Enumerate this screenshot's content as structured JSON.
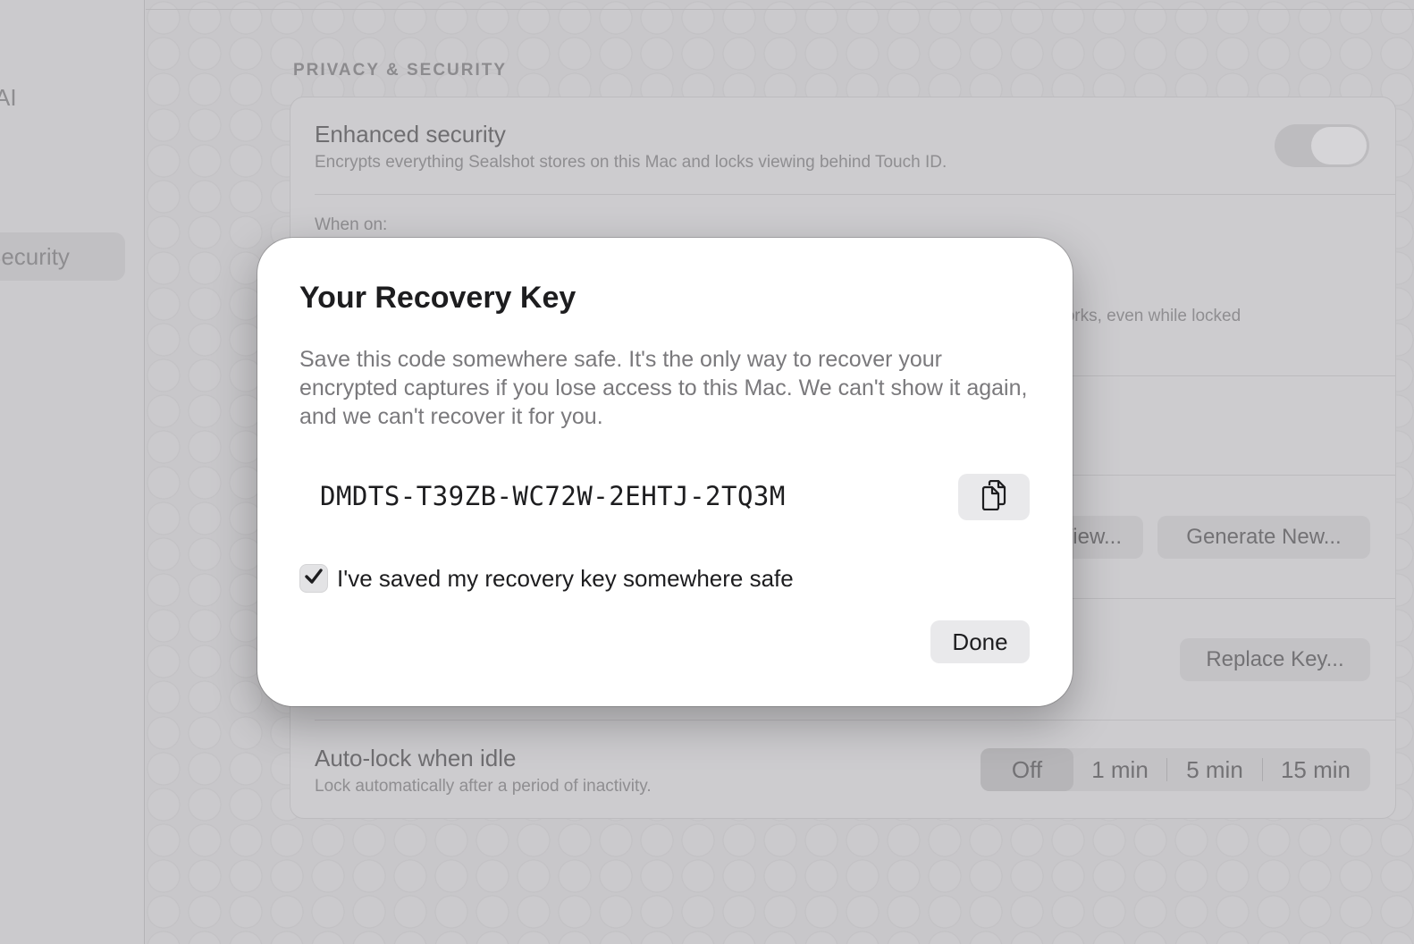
{
  "sidebar": {
    "items": [
      {
        "label": "AI"
      },
      {
        "label": "Security"
      }
    ]
  },
  "settings": {
    "section_title": "PRIVACY & SECURITY",
    "enhanced_security": {
      "title": "Enhanced security",
      "subtitle": "Encrypts everything Sealshot stores on this Mac and locks viewing behind Touch ID.",
      "enabled": true
    },
    "when_on_label": "When on:",
    "partial_text": "works, even while locked",
    "view_button_partial": "View...",
    "generate_button": "Generate New...",
    "replace_button": "Replace Key...",
    "auto_lock": {
      "title": "Auto-lock when idle",
      "subtitle": "Lock automatically after a period of inactivity.",
      "options": [
        "Off",
        "1 min",
        "5 min",
        "15 min"
      ],
      "selected": "Off"
    }
  },
  "dialog": {
    "title": "Your Recovery Key",
    "body": "Save this code somewhere safe. It's the only way to recover your encrypted captures if you lose access to this Mac. We can't show it again, and we can't recover it for you.",
    "recovery_key": "DMDTS-T39ZB-WC72W-2EHTJ-2TQ3M",
    "copy_icon": "copy-icon",
    "checkbox_checked": true,
    "checkbox_label": "I've saved my recovery key somewhere safe",
    "done_label": "Done"
  }
}
